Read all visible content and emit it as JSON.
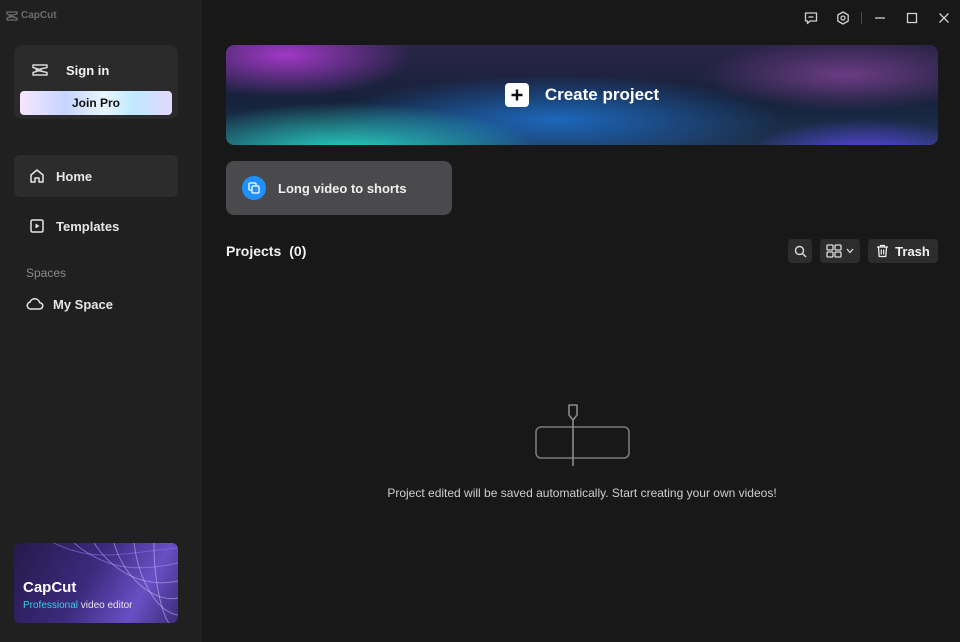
{
  "app": {
    "name": "CapCut"
  },
  "account": {
    "signin_label": "Sign in",
    "join_pro_label": "Join Pro"
  },
  "nav": {
    "items": [
      {
        "label": "Home",
        "icon": "home-icon",
        "active": true
      },
      {
        "label": "Templates",
        "icon": "templates-icon",
        "active": false
      }
    ],
    "spaces_heading": "Spaces",
    "my_space_label": "My Space"
  },
  "promo": {
    "title": "CapCut",
    "subtitle_accent": "Professional",
    "subtitle_rest": " video editor"
  },
  "titlebar": {
    "icons": [
      "feedback-icon",
      "settings-icon",
      "minimize-icon",
      "maximize-icon",
      "close-icon"
    ]
  },
  "main": {
    "create_project_label": "Create project",
    "long_video_label": "Long video to shorts",
    "projects_title": "Projects",
    "projects_count": "(0)",
    "trash_label": "Trash",
    "empty_message": "Project edited will be saved automatically. Start creating your own videos!"
  },
  "colors": {
    "accent_blue": "#1e90ff",
    "promo_accent": "#3fd0e8",
    "background": "#181818",
    "sidebar": "#202020"
  }
}
